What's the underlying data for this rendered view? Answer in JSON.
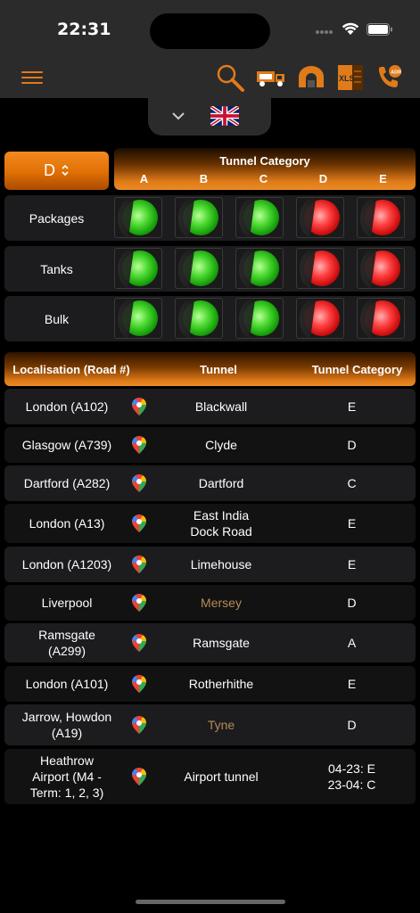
{
  "status": {
    "time": "22:31"
  },
  "toolbar": {
    "icons": [
      "menu-icon",
      "search-icon",
      "truck-icon",
      "tunnel-icon",
      "xls-export-icon",
      "adr-phone-icon"
    ],
    "xls_label": "XLS",
    "adr_label": "ADR"
  },
  "language": {
    "flag": "uk-flag-icon"
  },
  "selector": {
    "value": "D"
  },
  "tunnel_category_header": {
    "title": "Tunnel Category",
    "letters": [
      "A",
      "B",
      "C",
      "D",
      "E"
    ]
  },
  "rows": [
    {
      "label": "Packages",
      "lights": [
        "green",
        "green",
        "green",
        "red",
        "red"
      ]
    },
    {
      "label": "Tanks",
      "lights": [
        "green",
        "green",
        "green",
        "red",
        "red"
      ]
    },
    {
      "label": "Bulk",
      "lights": [
        "green",
        "green",
        "green",
        "red",
        "red"
      ]
    }
  ],
  "table_header": {
    "col1": "Localisation (Road #)",
    "col2": "Tunnel",
    "col3": "Tunnel Category"
  },
  "tunnels": [
    {
      "loc": "London (A102)",
      "name": "Blackwall",
      "cat": "E"
    },
    {
      "loc": "Glasgow (A739)",
      "name": "Clyde",
      "cat": "D"
    },
    {
      "loc": "Dartford (A282)",
      "name": "Dartford",
      "cat": "C"
    },
    {
      "loc": "London (A13)",
      "name": "East India\nDock Road",
      "cat": "E"
    },
    {
      "loc": "London (A1203)",
      "name": "Limehouse",
      "cat": "E"
    },
    {
      "loc": "Liverpool",
      "name": "Mersey",
      "cat": "D"
    },
    {
      "loc": "Ramsgate\n(A299)",
      "name": "Ramsgate",
      "cat": "A"
    },
    {
      "loc": "London (A101)",
      "name": "Rotherhithe",
      "cat": "E"
    },
    {
      "loc": "Jarrow, Howdon\n(A19)",
      "name": "Tyne",
      "cat": "D"
    },
    {
      "loc": "Heathrow\nAirport (M4 -\nTerm: 1, 2, 3)",
      "name": "Airport tunnel",
      "cat": "04-23: E\n23-04: C"
    }
  ],
  "colors": {
    "accent": "#e07b1a",
    "muted_link": "#b48a55",
    "row_bg": "#1c1c1e"
  }
}
